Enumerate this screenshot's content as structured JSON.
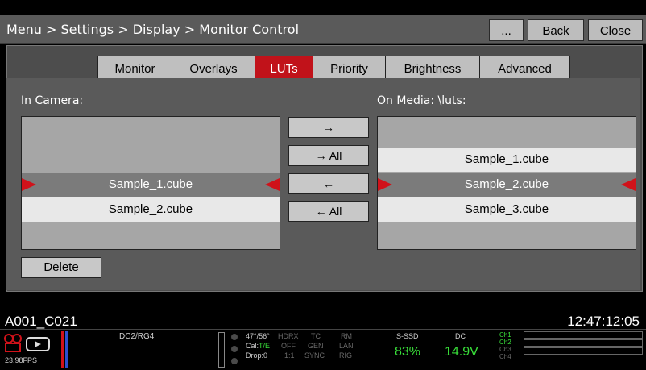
{
  "header": {
    "breadcrumb": "Menu > Settings > Display > Monitor Control",
    "more_label": "...",
    "back_label": "Back",
    "close_label": "Close"
  },
  "tabs": [
    {
      "label": "Monitor",
      "active": false
    },
    {
      "label": "Overlays",
      "active": false
    },
    {
      "label": "LUTs",
      "active": true
    },
    {
      "label": "Priority",
      "active": false
    },
    {
      "label": "Brightness",
      "active": false
    },
    {
      "label": "Advanced",
      "active": false
    }
  ],
  "in_camera": {
    "label": "In Camera:",
    "items": [
      "Sample_1.cube",
      "Sample_2.cube"
    ],
    "selected": "Sample_1.cube"
  },
  "on_media": {
    "label": "On Media: \\luts:",
    "items": [
      "Sample_1.cube",
      "Sample_2.cube",
      "Sample_3.cube"
    ],
    "selected": "Sample_2.cube"
  },
  "transfer": {
    "to_media": "→",
    "all_to_media": "→ All",
    "to_camera": "←",
    "all_to_camera": "← All"
  },
  "delete_label": "Delete",
  "status": {
    "clip_name": "A001_C021",
    "timecode": "12:47:12:05",
    "fps": "23.98FPS",
    "format": "DC2/RG4",
    "temp": "47°/56°",
    "cal_prefix": "Cal:",
    "cal_value": "T/E",
    "drop": "Drop:0",
    "hdrx": "HDRX",
    "hdrx_val": "OFF",
    "hdrx_ratio": "1:1",
    "tc": "TC",
    "tc_val": "GEN",
    "tc_sync": "SYNC",
    "rm": "RM",
    "rm_val": "LAN",
    "rm_rig": "RIG",
    "media_label": "S-SSD",
    "media_value": "83%",
    "power_label": "DC",
    "power_value": "14.9V",
    "channels": [
      "Ch1",
      "Ch2",
      "Ch3",
      "Ch4"
    ],
    "accent": "#39e03a",
    "record_color": "#d0121a"
  }
}
